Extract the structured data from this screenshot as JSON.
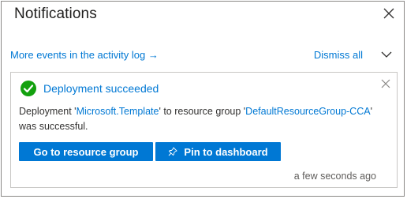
{
  "panel": {
    "title": "Notifications",
    "close_icon": "close-icon"
  },
  "header": {
    "activity_link": "More events in the activity log",
    "activity_arrow": "→",
    "dismiss_all": "Dismiss all",
    "chevron_icon": "chevron-down-icon"
  },
  "notification": {
    "status_icon": "success-checkmark-icon",
    "status_color": "#13a10e",
    "title": "Deployment succeeded",
    "body_prefix": "Deployment '",
    "template_name": "Microsoft.Template",
    "body_middle": "' to resource group '",
    "resource_group": "DefaultResourceGroup-CCA",
    "body_suffix": "' was successful.",
    "primary_button": "Go to resource group",
    "pin_button": "Pin to dashboard",
    "pin_icon": "pin-icon",
    "timestamp": "a few seconds ago",
    "dismiss_icon": "close-icon"
  },
  "colors": {
    "accent": "#0078d4",
    "success": "#13a10e",
    "text": "#323130"
  }
}
